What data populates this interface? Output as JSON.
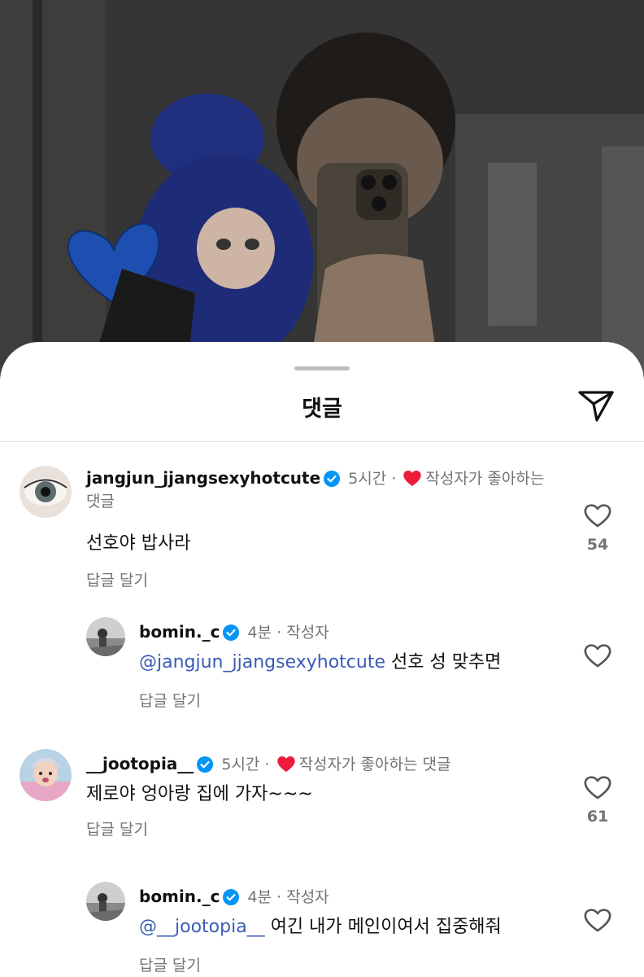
{
  "sheet": {
    "title": "댓글"
  },
  "comments": [
    {
      "username": "jangjun_jjangsexyhotcute",
      "time": "5시간",
      "sep": "·",
      "badge": "작성자가 좋아하는 댓글",
      "text": "선호야 밥사라",
      "reply": "답글 달기",
      "likes": "54"
    },
    {
      "username": "bomin._c",
      "time": "4분",
      "sep": "·",
      "role": "작성자",
      "mention": "@jangjun_jjangsexyhotcute",
      "text": "선호 성 맞추면",
      "reply": "답글 달기"
    },
    {
      "username": "__jootopia__",
      "time": "5시간",
      "sep": "·",
      "badge": "작성자가 좋아하는 댓글",
      "text": "제로야 엉아랑 집에 가자~~~",
      "reply": "답글 달기",
      "likes": "61"
    },
    {
      "username": "bomin._c",
      "time": "4분",
      "sep": "·",
      "role": "작성자",
      "mention": "@__jootopia__",
      "text": "여긴 내가 메인이여서 집중해줘",
      "reply": "답글 달기"
    }
  ],
  "colors": {
    "verified": "#0095f6",
    "heart": "#ed1c3a",
    "mention": "#3a5bb7",
    "muted": "#737373"
  }
}
